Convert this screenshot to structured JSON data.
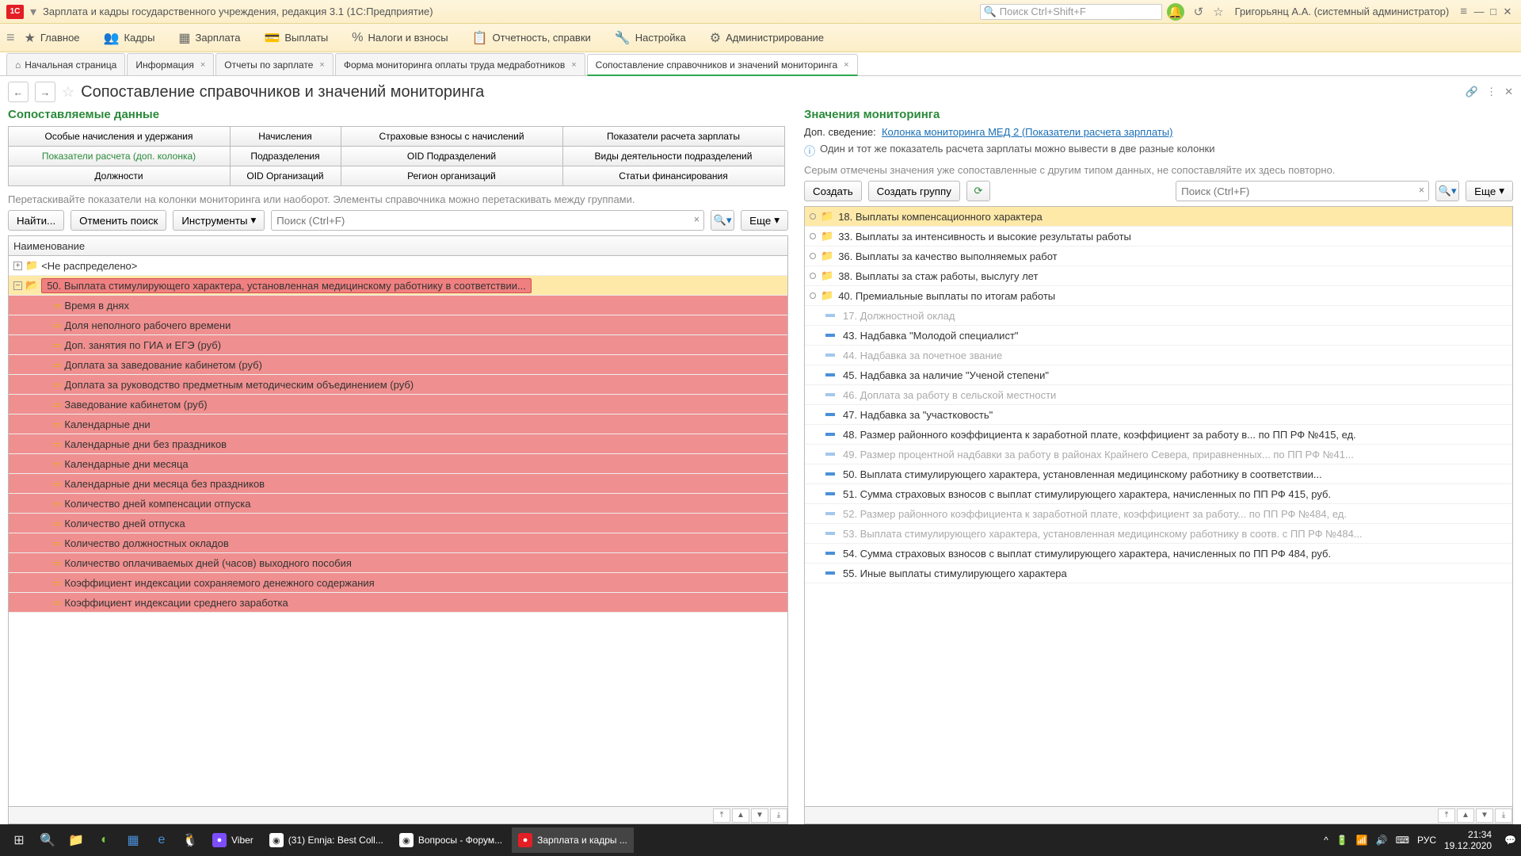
{
  "title_bar": {
    "logo_text": "1C",
    "app_title": "Зарплата и кадры государственного учреждения, редакция 3.1  (1С:Предприятие)",
    "search_placeholder": "Поиск Ctrl+Shift+F",
    "user": "Григорьянц А.А. (системный администратор)"
  },
  "main_menu": [
    "Главное",
    "Кадры",
    "Зарплата",
    "Выплаты",
    "Налоги и взносы",
    "Отчетность, справки",
    "Настройка",
    "Администрирование"
  ],
  "tabs": [
    {
      "label": "Начальная страница",
      "home": true,
      "closable": false
    },
    {
      "label": "Информация",
      "closable": true
    },
    {
      "label": "Отчеты по зарплате",
      "closable": true
    },
    {
      "label": "Форма мониторинга оплаты труда медработников",
      "closable": true
    },
    {
      "label": "Сопоставление справочников и значений мониторинга",
      "closable": true,
      "active": true
    }
  ],
  "page_title": "Сопоставление справочников и значений мониторинга",
  "left": {
    "section_title": "Сопоставляемые данные",
    "filter_buttons": [
      [
        "Особые начисления и удержания",
        "Начисления",
        "Страховые взносы с начислений",
        "Показатели расчета зарплаты"
      ],
      [
        "Показатели расчета (доп. колонка)",
        "Подразделения",
        "OID Подразделений",
        "Виды деятельности подразделений"
      ],
      [
        "Должности",
        "OID Организаций",
        "Регион организаций",
        "Статьи финансирования"
      ]
    ],
    "selected_filter": "Показатели расчета (доп. колонка)",
    "note": "Перетаскивайте показатели на колонки мониторинга или наоборот. Элементы справочника можно перетаскивать между группами.",
    "toolbar": {
      "find": "Найти...",
      "cancel_search": "Отменить поиск",
      "tools": "Инструменты",
      "search_placeholder": "Поиск (Ctrl+F)",
      "more": "Еще"
    },
    "tree_header": "Наименование",
    "tree": {
      "group_unassigned": "<Не распределено>",
      "group_selected": "50. Выплата стимулирующего характера, установленная медицинскому работнику в соответствии...",
      "children": [
        "Время в днях",
        "Доля неполного рабочего времени",
        "Доп. занятия по ГИА и ЕГЭ (руб)",
        "Доплата за заведование кабинетом (руб)",
        "Доплата за руководство предметным методическим объединением (руб)",
        "Заведование кабинетом (руб)",
        "Календарные дни",
        "Календарные дни без праздников",
        "Календарные дни месяца",
        "Календарные дни месяца без праздников",
        "Количество дней компенсации отпуска",
        "Количество дней отпуска",
        "Количество должностных окладов",
        "Количество оплачиваемых дней (часов) выходного пособия",
        "Коэффициент индексации сохраняемого денежного содержания",
        "Коэффициент индексации среднего заработка"
      ]
    }
  },
  "right": {
    "section_title": "Значения мониторинга",
    "link_prefix": "Доп. сведение:",
    "link_text": "Колонка мониторинга МЕД 2 (Показатели расчета зарплаты)",
    "info": "Один и тот же показатель расчета зарплаты можно вывести в две разные колонки",
    "gray_hint": "Серым отмечены значения уже сопоставленные с другим типом данных, не сопоставляйте их здесь повторно.",
    "toolbar": {
      "create": "Создать",
      "create_group": "Создать группу",
      "search_placeholder": "Поиск (Ctrl+F)",
      "more": "Еще"
    },
    "items": [
      {
        "type": "folder",
        "label": "18. Выплаты компенсационного характера",
        "highlighted": true,
        "expandable": true
      },
      {
        "type": "folder",
        "label": "33. Выплаты за интенсивность и высокие результаты работы",
        "expandable": true
      },
      {
        "type": "folder",
        "label": "36. Выплаты за качество выполняемых работ",
        "expandable": true
      },
      {
        "type": "folder",
        "label": "38. Выплаты за стаж работы, выслугу лет",
        "expandable": true
      },
      {
        "type": "folder",
        "label": "40. Премиальные выплаты по итогам работы",
        "expandable": true
      },
      {
        "type": "value",
        "label": "17. Должностной оклад",
        "dim": true
      },
      {
        "type": "value",
        "label": "43. Надбавка \"Молодой специалист\""
      },
      {
        "type": "value",
        "label": "44. Надбавка за почетное звание",
        "dim": true
      },
      {
        "type": "value",
        "label": "45. Надбавка за наличие \"Ученой степени\""
      },
      {
        "type": "value",
        "label": "46. Доплата за работу в сельской местности",
        "dim": true
      },
      {
        "type": "value",
        "label": "47. Надбавка за \"участковость\""
      },
      {
        "type": "value",
        "label": "48. Размер районного коэффициента к заработной плате, коэффициент за работу в... по ПП РФ №415, ед."
      },
      {
        "type": "value",
        "label": "49. Размер процентной надбавки за работу в районах Крайнего Севера, приравненных... по ПП РФ №41...",
        "dim": true
      },
      {
        "type": "value",
        "label": "50. Выплата стимулирующего характера, установленная медицинскому работнику в соответствии..."
      },
      {
        "type": "value",
        "label": "51. Сумма страховых взносов с выплат стимулирующего характера, начисленных по ПП РФ 415, руб."
      },
      {
        "type": "value",
        "label": "52. Размер районного коэффициента к заработной плате, коэффициент за работу... по ПП РФ №484, ед.",
        "dim": true
      },
      {
        "type": "value",
        "label": "53. Выплата стимулирующего характера, установленная медицинскому работнику в соотв. с ПП РФ №484...",
        "dim": true
      },
      {
        "type": "value",
        "label": "54. Сумма страховых взносов с выплат стимулирующего характера, начисленных по ПП РФ 484, руб."
      },
      {
        "type": "value",
        "label": "55. Иные выплаты стимулирующего характера"
      }
    ]
  },
  "taskbar": {
    "apps": [
      {
        "label": "Viber",
        "color": "#7c4dff"
      },
      {
        "label": "(31) Ennja: Best Coll...",
        "color": "#fff",
        "chrome": true
      },
      {
        "label": "Вопросы - Форум...",
        "color": "#fff",
        "chrome": true
      },
      {
        "label": "Зарплата и кадры ...",
        "color": "#e31e24",
        "active": true
      }
    ],
    "lang": "РУС",
    "time": "21:34",
    "date": "19.12.2020"
  }
}
